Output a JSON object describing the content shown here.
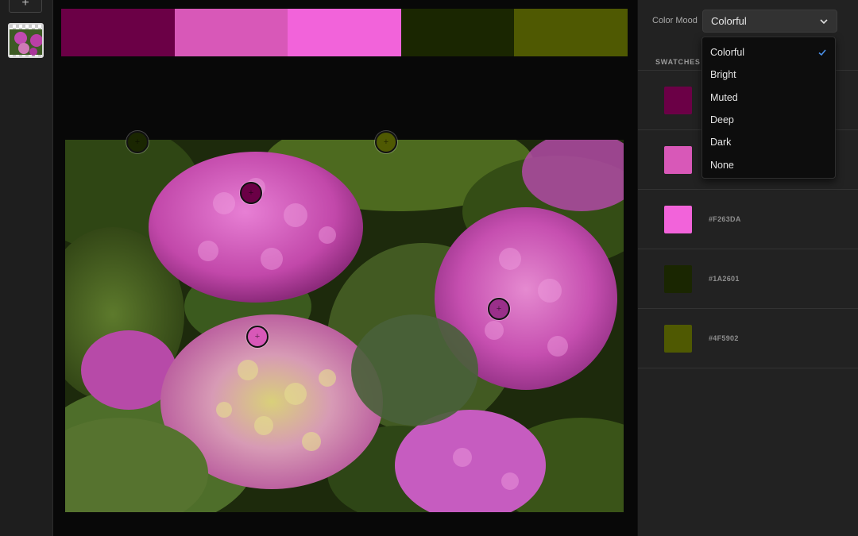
{
  "left_rail": {
    "add_label": "+"
  },
  "palette": {
    "colors": [
      "#6B0046",
      "#D858B8",
      "#F263DA",
      "#1A2601",
      "#4F5902"
    ]
  },
  "panel": {
    "color_mood_label": "Color Mood",
    "color_mood_value": "Colorful",
    "swatches_title": "SWATCHES",
    "swatches": [
      {
        "color": "#6B0046",
        "hex": ""
      },
      {
        "color": "#D858B8",
        "hex": ""
      },
      {
        "color": "#F263DA",
        "hex": "#F263DA"
      },
      {
        "color": "#1A2601",
        "hex": "#1A2601"
      },
      {
        "color": "#4F5902",
        "hex": "#4F5902"
      }
    ]
  },
  "dropdown": {
    "options": [
      "Colorful",
      "Bright",
      "Muted",
      "Deep",
      "Dark",
      "None"
    ],
    "selected": "Colorful"
  },
  "icons": {
    "dropdown_chevron": "chevron-down-icon",
    "selected_check": "checkmark-icon",
    "color_picker": "picker-handle-icon"
  },
  "accent_color": "#4a8fe7"
}
